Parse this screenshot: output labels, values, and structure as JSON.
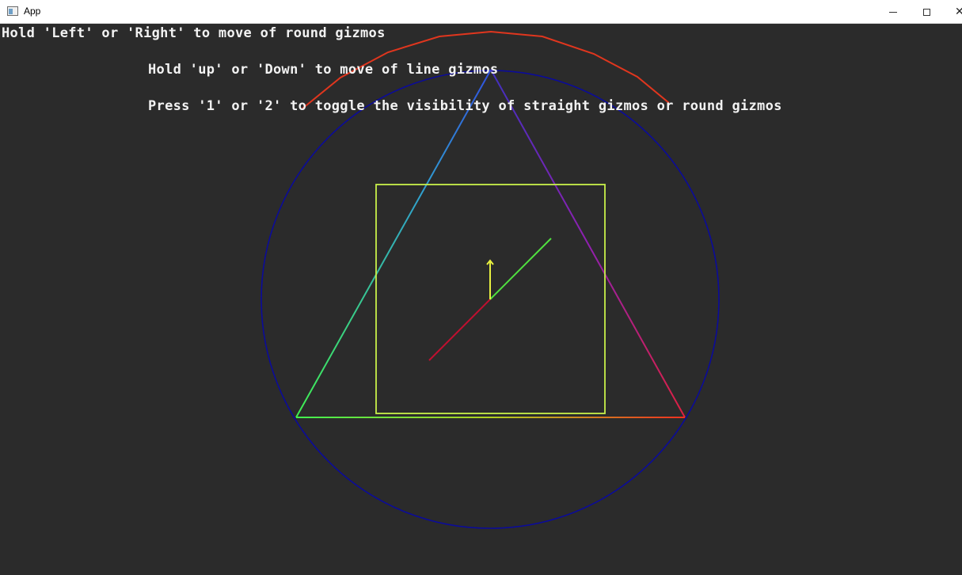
{
  "window": {
    "title": "App",
    "icon": "app-window-icon",
    "controls": [
      "minimize-icon",
      "maximize-icon",
      "close-icon"
    ]
  },
  "instructions": {
    "line1": "Hold 'Left' or 'Right' to move of round gizmos",
    "line2": "Hold 'up' or 'Down' to move of line gizmos",
    "line3": "Press '1' or '2' to toggle the visibility of straight gizmos or round gizmos"
  },
  "colors": {
    "background": "#2b2b2b",
    "circle": "#0b0b9a",
    "arc": "#e0361e",
    "rectangle": "#c8f04a",
    "axis_x": "#c01030",
    "axis_y": "#e8f040",
    "axis_z": "#50e040"
  }
}
